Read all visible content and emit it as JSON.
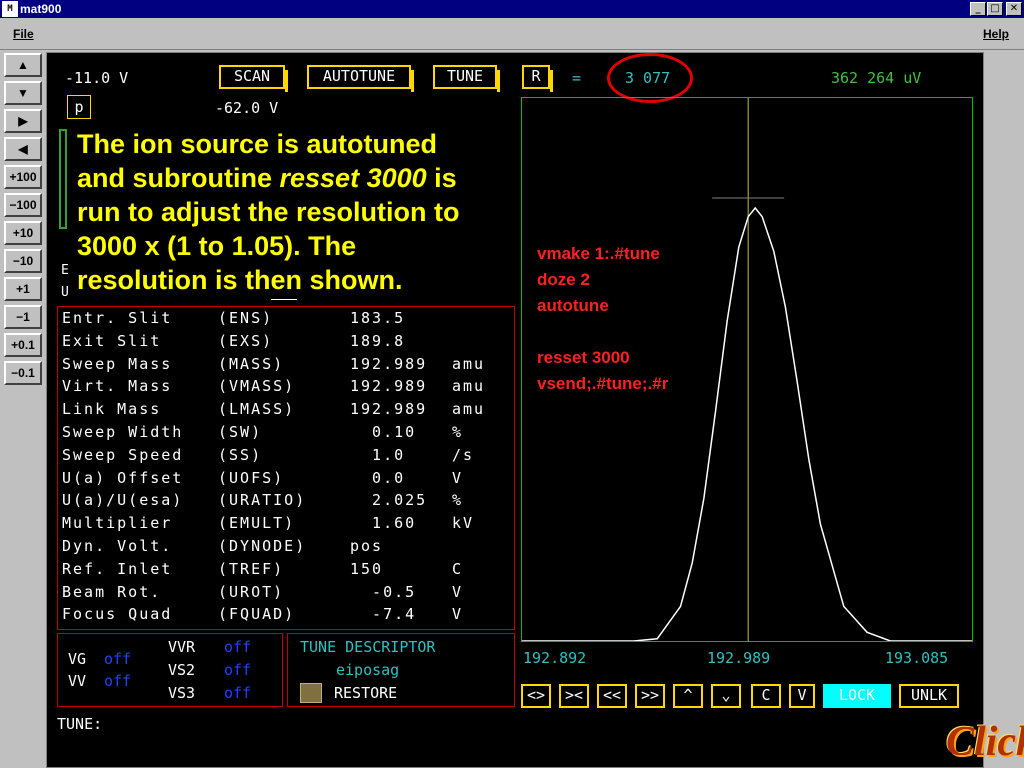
{
  "window": {
    "title": "mat900",
    "icon_text": "M",
    "min_glyph": "_",
    "max_glyph": "□",
    "close_glyph": "✕"
  },
  "menu": {
    "file": "File",
    "help": "Help"
  },
  "toolbar": {
    "up": "▲",
    "down": "▼",
    "right": "▶",
    "left": "◀",
    "p100": "+100",
    "m100": "−100",
    "p10": "+10",
    "m10": "−10",
    "p1": "+1",
    "m1": "−1",
    "p01": "+0.1",
    "m01": "−0.1"
  },
  "header": {
    "voltage_left": "-11.0 V",
    "p_label": "p",
    "voltage_p": "-62.0 V",
    "scan": "SCAN",
    "autotune": "AUTOTUNE",
    "tune": "TUNE",
    "r": "R",
    "equals": "=",
    "resolution": "3 077",
    "intensity": "362 264 uV"
  },
  "side_letters": {
    "e": "E",
    "u": "U"
  },
  "annotation": {
    "line1": "The ion source is autotuned",
    "line2a": "and subroutine ",
    "line2b": "resset 3000",
    "line2c": " is",
    "line3": "run to adjust the resolution to",
    "line4": "3000 x (1 to 1.05).  The",
    "line5": "resolution is then shown."
  },
  "commands": [
    "vmake 1:.#tune",
    "doze 2",
    "autotune",
    "",
    "resset 3000",
    "vsend;.#tune;.#r"
  ],
  "parameters": [
    {
      "name": "Entr. Slit",
      "code": "(ENS)",
      "value": "183.5",
      "unit": ""
    },
    {
      "name": "Exit Slit",
      "code": "(EXS)",
      "value": "189.8",
      "unit": ""
    },
    {
      "name": "Sweep Mass",
      "code": "(MASS)",
      "value": "192.989",
      "unit": "amu"
    },
    {
      "name": "Virt. Mass",
      "code": "(VMASS)",
      "value": "192.989",
      "unit": "amu"
    },
    {
      "name": "Link Mass",
      "code": "(LMASS)",
      "value": "192.989",
      "unit": "amu"
    },
    {
      "name": "Sweep Width",
      "code": "(SW)",
      "value": "  0.10",
      "unit": "%"
    },
    {
      "name": "Sweep Speed",
      "code": "(SS)",
      "value": "  1.0",
      "unit": "/s"
    },
    {
      "name": "U(a) Offset",
      "code": "(UOFS)",
      "value": "  0.0",
      "unit": "V"
    },
    {
      "name": "U(a)/U(esa)",
      "code": "(URATIO)",
      "value": "  2.025",
      "unit": "%"
    },
    {
      "name": "Multiplier",
      "code": "(EMULT)",
      "value": "  1.60",
      "unit": "kV"
    },
    {
      "name": "Dyn. Volt.",
      "code": "(DYNODE)",
      "value": "pos",
      "unit": ""
    },
    {
      "name": "Ref. Inlet",
      "code": "(TREF)",
      "value": "150",
      "unit": "C"
    },
    {
      "name": "Beam Rot.",
      "code": "(UROT)",
      "value": "  -0.5",
      "unit": "V"
    },
    {
      "name": "Focus Quad",
      "code": "(FQUAD)",
      "value": "  -7.4",
      "unit": "V"
    }
  ],
  "valves": {
    "vg": "VG",
    "vg_state": "off",
    "vv": "VV",
    "vv_state": "off",
    "vvr": "VVR",
    "vvr_state": "off",
    "vs2": "VS2",
    "vs2_state": "off",
    "vs3": "VS3",
    "vs3_state": "off"
  },
  "tune_panel": {
    "title": "TUNE DESCRIPTOR",
    "name": "eiposag",
    "restore": "RESTORE"
  },
  "prompt": "TUNE:",
  "plot_axis": {
    "left": "192.892",
    "center": "192.989",
    "right": "193.085"
  },
  "plot_buttons": [
    "<>",
    "><",
    "<<",
    ">>",
    "^",
    "⌄",
    "C",
    "V",
    "LOCK",
    "UNLK"
  ],
  "chart_data": {
    "type": "line",
    "title": "",
    "xlabel": "",
    "ylabel": "",
    "xlim": [
      192.892,
      193.085
    ],
    "ylim": [
      0,
      1
    ],
    "series": [
      {
        "x": [
          192.892,
          192.9,
          192.92,
          192.94,
          192.95,
          192.96,
          192.965,
          192.97,
          192.975,
          192.98,
          192.985,
          192.989,
          192.992,
          192.995,
          193.0,
          193.005,
          193.01,
          193.015,
          193.02,
          193.03,
          193.04,
          193.05,
          193.06,
          193.085
        ],
        "y": [
          0,
          0,
          0,
          0,
          0.005,
          0.08,
          0.18,
          0.33,
          0.53,
          0.74,
          0.91,
          0.98,
          1.0,
          0.98,
          0.9,
          0.77,
          0.6,
          0.42,
          0.27,
          0.08,
          0.02,
          0,
          0,
          0
        ]
      }
    ],
    "markers": {
      "centerline_x": 192.989,
      "peak_crosshair_y": 1.0
    },
    "colors": {
      "trace": "#ffffff",
      "centerline": "#c0c040",
      "crosshair": "#808080",
      "frame": "#00c000"
    }
  },
  "colors": {
    "accent_yellow": "#ffd700",
    "highlight_yellow": "#ffff00",
    "mono_green": "#40c040",
    "cyan": "#30c0c0",
    "off_blue": "#2040ff",
    "lock_cyan": "#00ffff",
    "annot_red": "#ff2020",
    "circle_red": "#e00000"
  },
  "watermark": "Click"
}
